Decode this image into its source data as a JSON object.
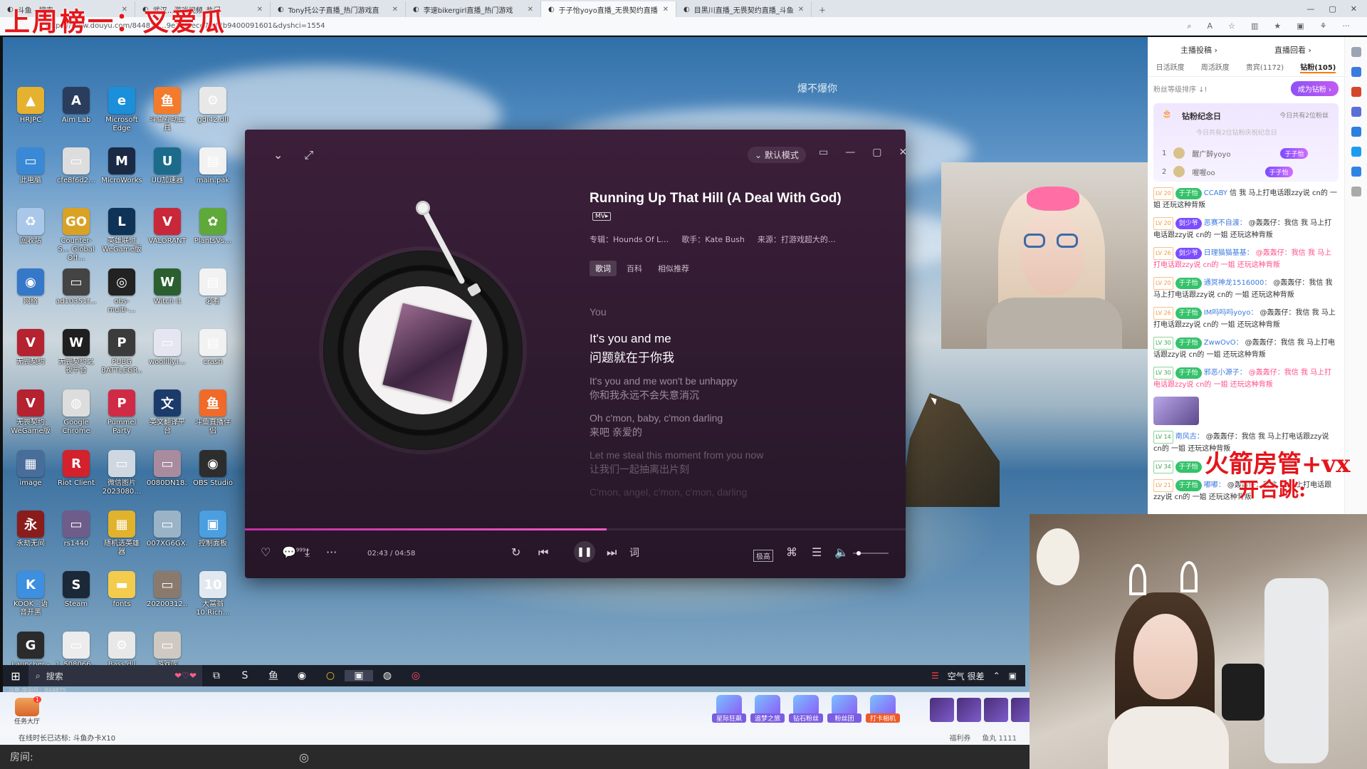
{
  "browser": {
    "tabs": [
      {
        "label": "斗鱼 - 搜索",
        "active": false
      },
      {
        "label": "武汉…游戏视频_热门",
        "active": false
      },
      {
        "label": "Tony托公子直播_热门游戏直",
        "active": false
      },
      {
        "label": "李速bikergirl直播_热门游戏",
        "active": false
      },
      {
        "label": "于子怡yoyo直播_无畏契约直播",
        "active": true
      },
      {
        "label": "目黑川直播_无畏契约直播_斗鱼",
        "active": false
      }
    ],
    "url": "https://www.douyu.com/844875…9e16f1ece7fbf2b9400091601&dyshci=1554",
    "new_tab_icon": "plus-icon"
  },
  "overlay": {
    "title": "上周榜一：叉爱瓜",
    "promo_line1": "火箭房管+vx",
    "promo_line2": "开合跳:"
  },
  "stream": {
    "watermark": "爆不爆你"
  },
  "desktop_icons": [
    {
      "label": "HRJPC",
      "color": "#e6b12f",
      "glyph": "▲"
    },
    {
      "label": "Aim Lab",
      "color": "#2a3d5c",
      "glyph": "A"
    },
    {
      "label": "Microsoft Edge",
      "color": "#1b8fd9",
      "glyph": "e"
    },
    {
      "label": "斗鱼互动工具",
      "color": "#f27b2c",
      "glyph": "鱼"
    },
    {
      "label": "gdi42.dll",
      "color": "#e8e8e8",
      "glyph": "⚙"
    },
    {
      "label": "此电脑",
      "color": "#3a89d6",
      "glyph": "▭"
    },
    {
      "label": "cfe8f6d2…",
      "color": "#dddddd",
      "glyph": "▭"
    },
    {
      "label": "MicroWorks",
      "color": "#1b2a44",
      "glyph": "M"
    },
    {
      "label": "UU加速器",
      "color": "#1c6b8a",
      "glyph": "U"
    },
    {
      "label": "main.pak",
      "color": "#f2f2f2",
      "glyph": "▤"
    },
    {
      "label": "回收站",
      "color": "#a9c7e8",
      "glyph": "♻"
    },
    {
      "label": "Counter-S… Global Off…",
      "color": "#d9a225",
      "glyph": "GO"
    },
    {
      "label": "英雄联盟 WeGame版",
      "color": "#0f3357",
      "glyph": "L"
    },
    {
      "label": "VALORANT",
      "color": "#c8283a",
      "glyph": "V"
    },
    {
      "label": "PlantsVs…",
      "color": "#5fa83a",
      "glyph": "✿"
    },
    {
      "label": "网络",
      "color": "#3578c8",
      "glyph": "◉"
    },
    {
      "label": "ad10351f…",
      "color": "#444",
      "glyph": "▭"
    },
    {
      "label": "obs-multi-…",
      "color": "#222",
      "glyph": "◎"
    },
    {
      "label": "Witch It",
      "color": "#2b5f2f",
      "glyph": "W"
    },
    {
      "label": "必看",
      "color": "#f2f2f2",
      "glyph": "▤"
    },
    {
      "label": "无畏契约",
      "color": "#b52230",
      "glyph": "V"
    },
    {
      "label": "无畏契约之夜平台",
      "color": "#1f1f1f",
      "glyph": "W"
    },
    {
      "label": "PUBG BATTLEGR…",
      "color": "#3b3b3b",
      "glyph": "P"
    },
    {
      "label": "woolilly.i…",
      "color": "#e6e6f3",
      "glyph": "▭"
    },
    {
      "label": "crash",
      "color": "#f2f2f2",
      "glyph": "▤"
    },
    {
      "label": "无畏契约 WeGame版",
      "color": "#b52230",
      "glyph": "V"
    },
    {
      "label": "Google Chrome",
      "color": "#dddddd",
      "glyph": "◍"
    },
    {
      "label": "Pummel Party",
      "color": "#d02b46",
      "glyph": "P"
    },
    {
      "label": "英文翻译平台",
      "color": "#1b3b6b",
      "glyph": "文"
    },
    {
      "label": "斗鱼直播伴侣",
      "color": "#f06a2a",
      "glyph": "鱼"
    },
    {
      "label": "image",
      "color": "#486d9a",
      "glyph": "▦"
    },
    {
      "label": "Riot Client",
      "color": "#d3212d",
      "glyph": "R"
    },
    {
      "label": "微信图片 2023080…",
      "color": "#cfd8e0",
      "glyph": "▭"
    },
    {
      "label": "0080DN18…",
      "color": "#a98b9e",
      "glyph": "▭"
    },
    {
      "label": "OBS Studio",
      "color": "#2d2d2d",
      "glyph": "◉"
    },
    {
      "label": "永劫无间",
      "color": "#8a1c1c",
      "glyph": "永"
    },
    {
      "label": "rs1440",
      "color": "#6e5c8a",
      "glyph": "▭"
    },
    {
      "label": "随机选英雄器",
      "color": "#e1b22c",
      "glyph": "▦"
    },
    {
      "label": "007XG6GX…",
      "color": "#9ab3c6",
      "glyph": "▭"
    },
    {
      "label": "控制面板",
      "color": "#4b9fe0",
      "glyph": "▣"
    },
    {
      "label": "KOOK - 语音开黑",
      "color": "#3d8fe0",
      "glyph": "K"
    },
    {
      "label": "Steam",
      "color": "#1b2838",
      "glyph": "S"
    },
    {
      "label": "fonts",
      "color": "#f3cc4d",
      "glyph": "▬"
    },
    {
      "label": "20200312…",
      "color": "#8a7a6e",
      "glyph": "▭"
    },
    {
      "label": "大富翁 10.Rich…",
      "color": "#e2e8ef",
      "glyph": "10"
    },
    {
      "label": "Launcher - 快捷方式",
      "color": "#2b2b2b",
      "glyph": "G"
    },
    {
      "label": "1_508066…",
      "color": "#ececec",
      "glyph": "▭"
    },
    {
      "label": "Bass.dll",
      "color": "#e8e8e8",
      "glyph": "⚙"
    },
    {
      "label": "游戏库",
      "color": "#cfc9c2",
      "glyph": "▭"
    }
  ],
  "player": {
    "mode_label": "默认模式",
    "song_title": "Running Up That Hill (A Deal With God)",
    "mv_badge": "MV▸",
    "album": "专辑：Hounds Of L…",
    "artist": "歌手：Kate Bush",
    "source": "来源：打游戏超大的…",
    "tabs": [
      {
        "label": "歌词",
        "active": true
      },
      {
        "label": "百科",
        "active": false
      },
      {
        "label": "相似推荐",
        "active": false
      }
    ],
    "prev_line": "You",
    "lyrics": [
      {
        "en": "It's you and me",
        "cn": "问题就在于你我",
        "state": "current"
      },
      {
        "en": "It's you and me won't be unhappy",
        "cn": "你和我永远不会失意消沉",
        "state": "normal"
      },
      {
        "en": "Oh c'mon, baby, c'mon darling",
        "cn": "来吧 亲爱的",
        "state": "normal"
      },
      {
        "en": "Let me steal this moment from you now",
        "cn": "让我们一起抽离出片刻",
        "state": "fade"
      },
      {
        "en": "C'mon, angel, c'mon, c'mon, darling",
        "cn": "",
        "state": "fade2"
      }
    ],
    "comment_count": "999+",
    "time": "02:43 / 04:58",
    "progress": 0.547,
    "volume": 0.1,
    "quality_label": "极高",
    "lyric_btn": "词"
  },
  "taskbar": {
    "search_placeholder": "搜索",
    "weather": "空气 很差"
  },
  "douyu": {
    "tasks_label": "任务大厅",
    "tasks_badge": "1",
    "gift_buttons": [
      "星际狂飙",
      "追梦之旅",
      "钻石粉丝",
      "粉丝团",
      "打卡相机"
    ],
    "status_left": "在线时长已达标: 斗鱼办卡X10",
    "status_right": [
      "福利券",
      "鱼丸 1111"
    ],
    "room_label": "房间:",
    "small_info": "斗鱼 房间号：844875"
  },
  "chat": {
    "top_links": [
      "主播投稿 ›",
      "直播回看 ›"
    ],
    "tabs": [
      {
        "label": "日活跃度",
        "active": false
      },
      {
        "label": "周活跃度",
        "active": false
      },
      {
        "label": "贵宾(1172)",
        "active": false
      },
      {
        "label": "钻粉(105)",
        "active": true
      }
    ],
    "rank_hint": "粉丝等级排序 ↓!",
    "become_btn": "成为钻粉 ›",
    "memorial_title": "钻粉纪念日",
    "memorial_right": "今日共有2位粉丝",
    "memorial_sub": "今日共有2位钻粉庆祝纪念日",
    "memorial_users": [
      {
        "rank": "1",
        "name": "醒广醉yoyo",
        "tag": "于子怡"
      },
      {
        "rank": "2",
        "name": "喔喔oo",
        "tag": "于子怡"
      }
    ],
    "messages": [
      {
        "lv": "LV 20",
        "badge": "于子怡",
        "user": "CCABY",
        "text": "信 我 马上打电话跟zzy说 cn的 一姐 还玩这种背叛",
        "pink": false
      },
      {
        "lv": "LV 20",
        "badge": "剑少爷",
        "user": "恶赛不自渡：",
        "text": "@轰轰仔：我信 我 马上打电话跟zzy说 cn的 一姐 还玩这种背叛",
        "pink": false
      },
      {
        "lv": "LV 26",
        "badge": "剑少爷",
        "user": "日理猫猫基基：",
        "text": "@轰轰仔：我信 我 马上打电话跟zzy说 cn的 一姐 还玩这种背叛",
        "pink": true
      },
      {
        "lv": "LV 20",
        "badge": "于子怡",
        "user": "通冥神龙1516000：",
        "text": "@轰轰仔：我信 我 马上打电话跟zzy说 cn的 一姐 还玩这种背叛",
        "pink": false
      },
      {
        "lv": "LV 26",
        "badge": "于子怡",
        "user": "IM吗吗吗yoyo：",
        "text": "@轰轰仔：我信 我 马上打电话跟zzy说 cn的 一姐 还玩这种背叛",
        "pink": false
      },
      {
        "lv": "LV 30",
        "badge": "于子怡",
        "user": "ZwwOvO：",
        "text": "@轰轰仔：我信 我 马上打电话跟zzy说 cn的 一姐 还玩这种背叛",
        "pink": false
      },
      {
        "lv": "LV 30",
        "badge": "于子怡",
        "user": "邪恶小源子：",
        "text": "@轰轰仔：我信 我 马上打电话跟zzy说 cn的 一姐 还玩这种背叛",
        "pink": true
      },
      {
        "lv": "LV 14",
        "badge": "",
        "user": "南风古：",
        "text": "@轰轰仔：我信 我 马上打电话跟zzy说 cn的 一姐 还玩这种背叛",
        "pink": false
      },
      {
        "lv": "LV 34",
        "badge": "于子怡",
        "user": "",
        "text": "",
        "pink": false
      },
      {
        "lv": "LV 21",
        "badge": "于子怡",
        "user": "嘟嘟：",
        "text": "@轰轰仔：我信 我 马上打电话跟zzy说 cn的 一姐 还玩这种背叛",
        "pink": false
      }
    ]
  },
  "colors": {
    "overlay_red": "#e4161c",
    "player_bg": "#3c1f3a",
    "progress": "#f25bc4",
    "accent_purple": "#7c4dff"
  }
}
